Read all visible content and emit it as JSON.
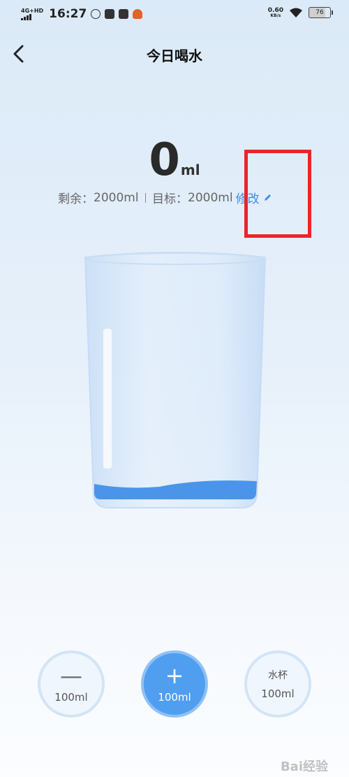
{
  "status_bar": {
    "network": "4G+HD",
    "time": "16:27",
    "speed_value": "0.60",
    "speed_unit": "KB/s",
    "battery": "76"
  },
  "header": {
    "title": "今日喝水"
  },
  "amount": {
    "value": "0",
    "unit": "ml"
  },
  "stats": {
    "remaining_label": "剩余：",
    "remaining_value": "2000ml",
    "target_label": "目标：",
    "target_value": "2000ml",
    "edit_label": "修改"
  },
  "controls": {
    "minus_label": "100ml",
    "plus_label": "100ml",
    "cup_title": "水杯",
    "cup_label": "100ml"
  },
  "watermark": "Bai经验",
  "colors": {
    "accent": "#4f9ef0",
    "edit": "#3d8be6",
    "highlight": "#e8262a",
    "water": "#4a95ea"
  },
  "progress": {
    "current_ml": 0,
    "target_ml": 2000
  }
}
